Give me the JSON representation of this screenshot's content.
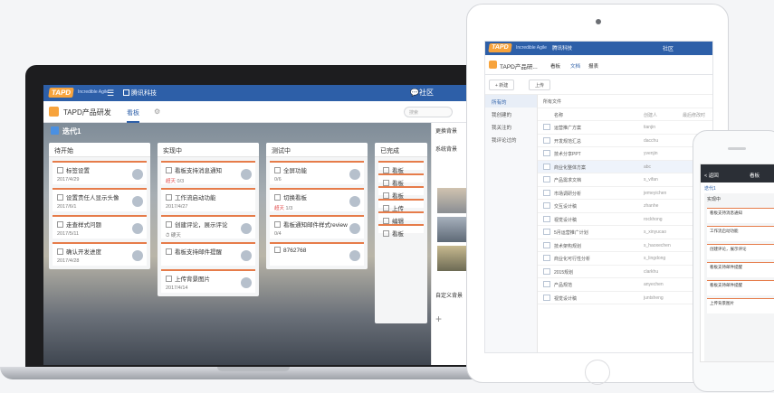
{
  "brand": {
    "logo": "TAPD",
    "tagline": "Incredible Agile",
    "org": "腾讯科技"
  },
  "laptop": {
    "community": "社区",
    "project": "TAPD产品研发",
    "tab": "看板",
    "search_placeholder": "搜索",
    "iteration": "迭代1",
    "columns": [
      {
        "title": "待开始",
        "cards": [
          {
            "title": "标签设置",
            "date": "2017/4/29"
          },
          {
            "title": "设置责任人显示头像",
            "date": "2017/6/1"
          },
          {
            "title": "走查样式问题",
            "date": "2017/5/11"
          },
          {
            "title": "确认开发进度",
            "date": "2017/4/28"
          }
        ]
      },
      {
        "title": "实现中",
        "cards": [
          {
            "title": "看板支持消息通知",
            "date": "",
            "overdue": "超天",
            "meta": "0/3"
          },
          {
            "title": "工作流启动功能",
            "date": "2017/4/27"
          },
          {
            "title": "创建评论，展示评论",
            "date": "",
            "meta": "⏱ 硬天"
          },
          {
            "title": "看板支持邮件提醒",
            "date": ""
          },
          {
            "title": "上传背景图片",
            "date": "2017/4/14"
          }
        ]
      },
      {
        "title": "测试中",
        "cards": [
          {
            "title": "全屏功能",
            "date": "",
            "meta": "0/6"
          },
          {
            "title": "切换看板",
            "date": "",
            "overdue": "超天",
            "meta": "1/3"
          },
          {
            "title": "看板通知邮件样式review",
            "date": "",
            "meta": "0/4"
          },
          {
            "title": "8762768",
            "date": ""
          }
        ]
      },
      {
        "title": "已完成",
        "cards": [
          {
            "title": "看板",
            "date": ""
          },
          {
            "title": "看板",
            "date": ""
          },
          {
            "title": "看板",
            "date": ""
          },
          {
            "title": "上传",
            "date": ""
          },
          {
            "title": "编辑",
            "date": ""
          },
          {
            "title": "看板",
            "date": ""
          }
        ]
      }
    ],
    "sidebar": {
      "title": "更换背景",
      "system": "系统背景",
      "custom": "自定义背景"
    }
  },
  "tablet": {
    "community": "社区",
    "project": "TAPD产品研...",
    "tabs": [
      "看板",
      "文档",
      "报表"
    ],
    "buttons": [
      "+ 新建",
      "上传"
    ],
    "nav": [
      "所有的",
      "我创建的",
      "我关注的",
      "我评论过的"
    ],
    "list_title": "所有文件",
    "headers": {
      "name": "名称",
      "creator": "创建人",
      "updated": "最后修改时"
    },
    "files": [
      {
        "name": "运营推广方案",
        "creator": "tianjin"
      },
      {
        "name": "开发规范汇总",
        "creator": "dacchu"
      },
      {
        "name": "技术分享PPT",
        "creator": "yvenjin"
      },
      {
        "name": "商业化整体方案",
        "creator": "abc"
      },
      {
        "name": "产品需求文档",
        "creator": "s_vifan"
      },
      {
        "name": "市场调研分析",
        "creator": "jemeyichen"
      },
      {
        "name": "交互设计稿",
        "creator": "zhanhe"
      },
      {
        "name": "视觉设计稿",
        "creator": "rockhong"
      },
      {
        "name": "5月运营推广计划",
        "creator": "s_xinyucao"
      },
      {
        "name": "技术架构规划",
        "creator": "s_haoxechen"
      },
      {
        "name": "商业化可行性分析",
        "creator": "s_lingdong"
      },
      {
        "name": "2015规划",
        "creator": "clarkhu"
      },
      {
        "name": "产品规范",
        "creator": "anyechen"
      },
      {
        "name": "视觉设计稿",
        "creator": "juntsheng"
      }
    ]
  },
  "phone": {
    "back": "< 返回",
    "title": "看板",
    "iteration": "迭代1",
    "column": "实现中",
    "cards": [
      "看板支持消息通知",
      "工作流启动功能",
      "创建评论，展示评论",
      "看板支持邮件提醒",
      "看板支持邮件提醒",
      "上传背景图片"
    ]
  }
}
